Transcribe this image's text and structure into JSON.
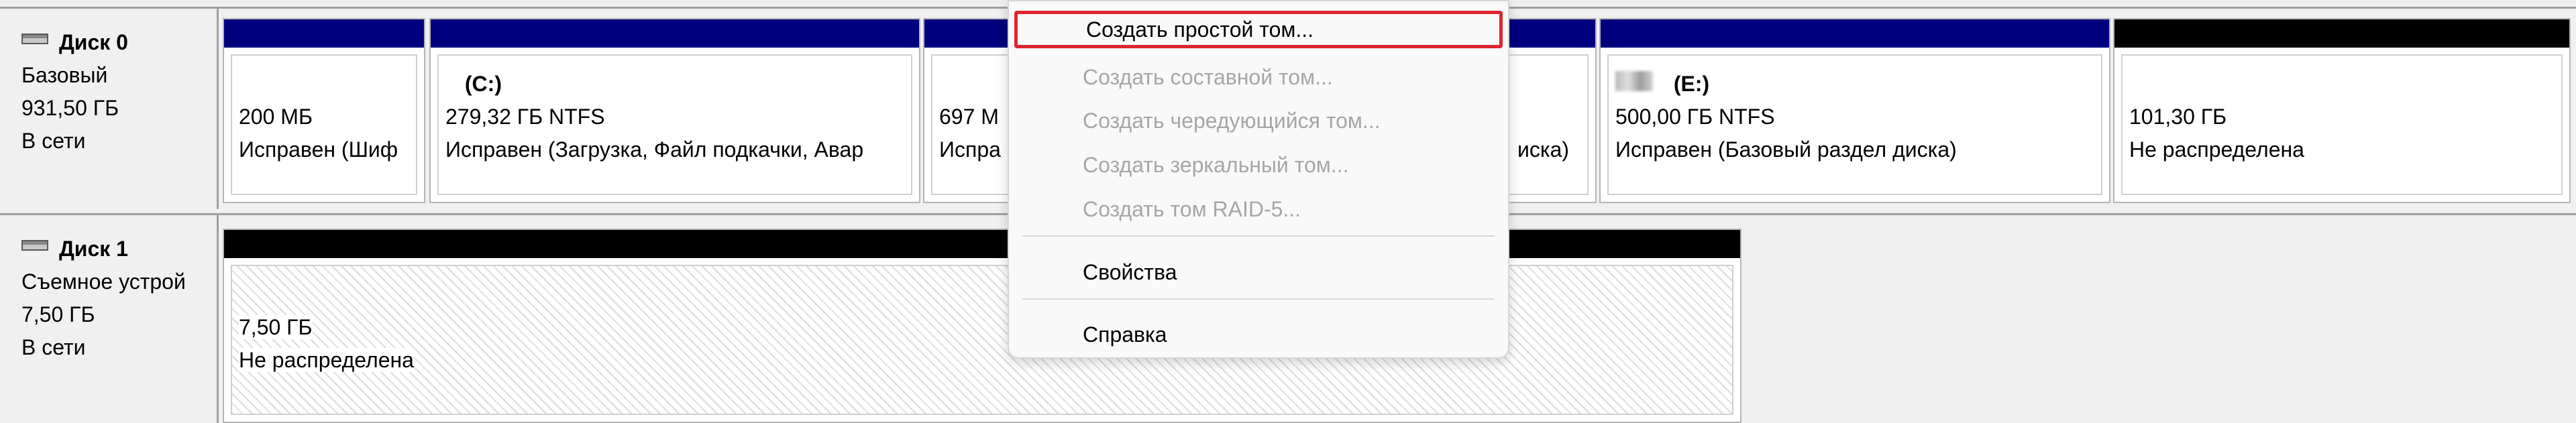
{
  "disks": [
    {
      "name": "Диск 0",
      "type": "Базовый",
      "size": "931,50 ГБ",
      "status": "В сети",
      "icon": "disk-drive-icon",
      "partitions": [
        {
          "title": "",
          "size_fs": "200 МБ",
          "status": "Исправен (Шиф"
        },
        {
          "title": "(C:)",
          "size_fs": "279,32 ГБ NTFS",
          "status": "Исправен (Загрузка, Файл подкачки, Авар"
        },
        {
          "title": "",
          "size_fs": "697 М",
          "status": "Испра"
        },
        {
          "title": "",
          "size_fs": "",
          "status": "иска)"
        },
        {
          "title": "(E:)",
          "size_fs": "500,00 ГБ NTFS",
          "status": "Исправен (Базовый раздел диска)"
        },
        {
          "title": "",
          "size_fs": "101,30 ГБ",
          "status": "Не распределена"
        }
      ]
    },
    {
      "name": "Диск 1",
      "type": "Съемное устрой",
      "size": "7,50 ГБ",
      "status": "В сети",
      "icon": "removable-drive-icon",
      "partitions": [
        {
          "title": "",
          "size_fs": "7,50 ГБ",
          "status": "Не распределена"
        }
      ]
    }
  ],
  "context_menu": {
    "items": [
      {
        "label": "Создать простой том...",
        "enabled": true,
        "highlighted": true
      },
      {
        "label": "Создать составной том...",
        "enabled": false
      },
      {
        "label": "Создать чередующийся том...",
        "enabled": false
      },
      {
        "label": "Создать зеркальный том...",
        "enabled": false
      },
      {
        "label": "Создать том RAID-5...",
        "enabled": false
      },
      {
        "label": "Свойства",
        "enabled": true
      },
      {
        "label": "Справка",
        "enabled": true
      }
    ]
  },
  "colors": {
    "primary_partition_bar": "#00007f",
    "unallocated_bar": "#000000",
    "highlight_outline": "#e0242c"
  }
}
